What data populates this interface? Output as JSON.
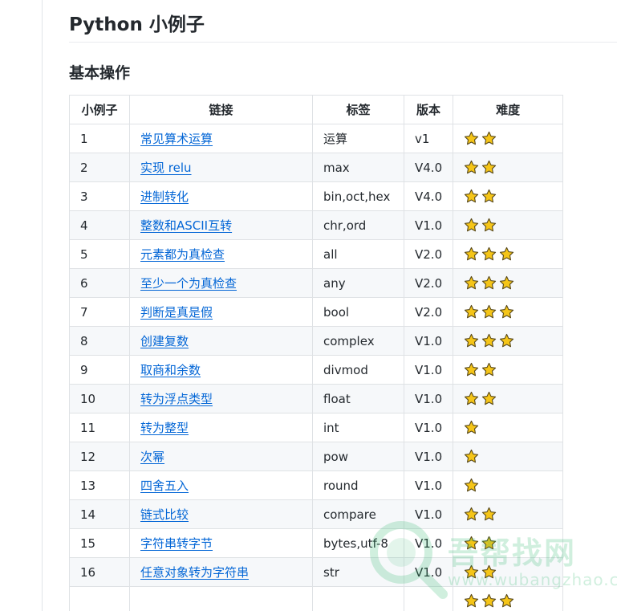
{
  "page": {
    "title": "Python 小例子",
    "section_title": "基本操作"
  },
  "table": {
    "headers": [
      "小例子",
      "链接",
      "标签",
      "版本",
      "难度"
    ],
    "rows": [
      {
        "idx": "1",
        "link": "常见算术运算",
        "tag": "运算",
        "version": "v1",
        "stars": 2
      },
      {
        "idx": "2",
        "link": "实现 relu",
        "tag": "max",
        "version": "V4.0",
        "stars": 2
      },
      {
        "idx": "3",
        "link": "进制转化",
        "tag": "bin,oct,hex",
        "version": "V4.0",
        "stars": 2
      },
      {
        "idx": "4",
        "link": "整数和ASCII互转",
        "tag": "chr,ord",
        "version": "V1.0",
        "stars": 2
      },
      {
        "idx": "5",
        "link": "元素都为真检查",
        "tag": "all",
        "version": "V2.0",
        "stars": 3
      },
      {
        "idx": "6",
        "link": "至少一个为真检查",
        "tag": "any",
        "version": "V2.0",
        "stars": 3
      },
      {
        "idx": "7",
        "link": "判断是真是假",
        "tag": "bool",
        "version": "V2.0",
        "stars": 3
      },
      {
        "idx": "8",
        "link": "创建复数",
        "tag": "complex",
        "version": "V1.0",
        "stars": 3
      },
      {
        "idx": "9",
        "link": "取商和余数",
        "tag": "divmod",
        "version": "V1.0",
        "stars": 2
      },
      {
        "idx": "10",
        "link": "转为浮点类型",
        "tag": "float",
        "version": "V1.0",
        "stars": 2
      },
      {
        "idx": "11",
        "link": "转为整型",
        "tag": "int",
        "version": "V1.0",
        "stars": 1
      },
      {
        "idx": "12",
        "link": "次幂",
        "tag": "pow",
        "version": "V1.0",
        "stars": 1
      },
      {
        "idx": "13",
        "link": "四舍五入",
        "tag": "round",
        "version": "V1.0",
        "stars": 1
      },
      {
        "idx": "14",
        "link": "链式比较",
        "tag": "compare",
        "version": "V1.0",
        "stars": 2
      },
      {
        "idx": "15",
        "link": "字符串转字节",
        "tag": "bytes,utf-8",
        "version": "V1.0",
        "stars": 2
      },
      {
        "idx": "16",
        "link": "任意对象转为字符串",
        "tag": "str",
        "version": "V1.0",
        "stars": 2
      },
      {
        "idx": "",
        "link": "",
        "tag": "",
        "version": "",
        "stars": 3
      }
    ]
  },
  "watermark": {
    "text": "吾帮找网",
    "sub": "www.wubangzhao.com"
  },
  "colors": {
    "link": "#0366d6",
    "star_fill": "#f5c518",
    "star_stroke": "#5a4a1a",
    "border": "#dfe2e5",
    "stripe": "#f6f8fa"
  },
  "icons": {
    "star": "star-icon",
    "watermark": "magnifier-icon"
  }
}
